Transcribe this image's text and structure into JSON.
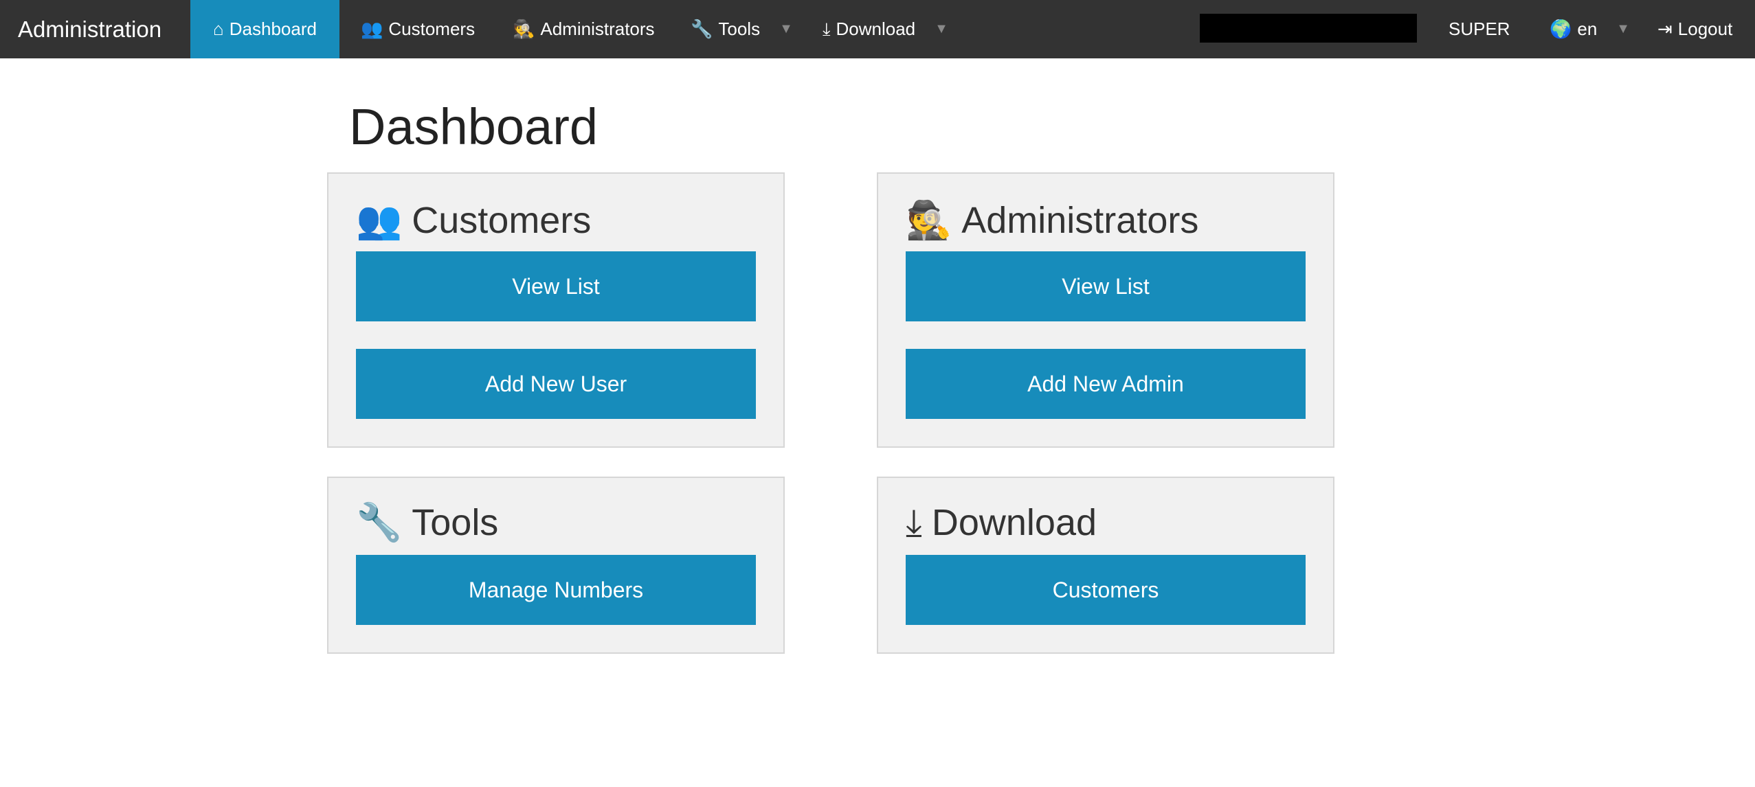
{
  "navbar": {
    "brand": "Administration",
    "items": [
      {
        "label": "Dashboard",
        "icon": "home-icon",
        "active": true
      },
      {
        "label": "Customers",
        "icon": "users-icon"
      },
      {
        "label": "Administrators",
        "icon": "user-secret-icon"
      },
      {
        "label": "Tools",
        "icon": "wrench-icon",
        "dropdown": true
      },
      {
        "label": "Download",
        "icon": "download-icon",
        "dropdown": true
      }
    ],
    "user": "SUPER",
    "language": "en",
    "logout": "Logout"
  },
  "colors": {
    "navbar": "#333333",
    "accent": "#178cbb",
    "panel": "#f1f1f1"
  },
  "page": {
    "title": "Dashboard"
  },
  "panels": [
    {
      "title": "Customers",
      "icon": "users-icon",
      "buttons": [
        "View List",
        "Add New User"
      ]
    },
    {
      "title": "Administrators",
      "icon": "user-secret-icon",
      "buttons": [
        "View List",
        "Add New Admin"
      ]
    },
    {
      "title": "Tools",
      "icon": "wrench-icon",
      "buttons": [
        "Manage Numbers"
      ]
    },
    {
      "title": "Download",
      "icon": "download-icon",
      "buttons": [
        "Customers"
      ]
    }
  ]
}
